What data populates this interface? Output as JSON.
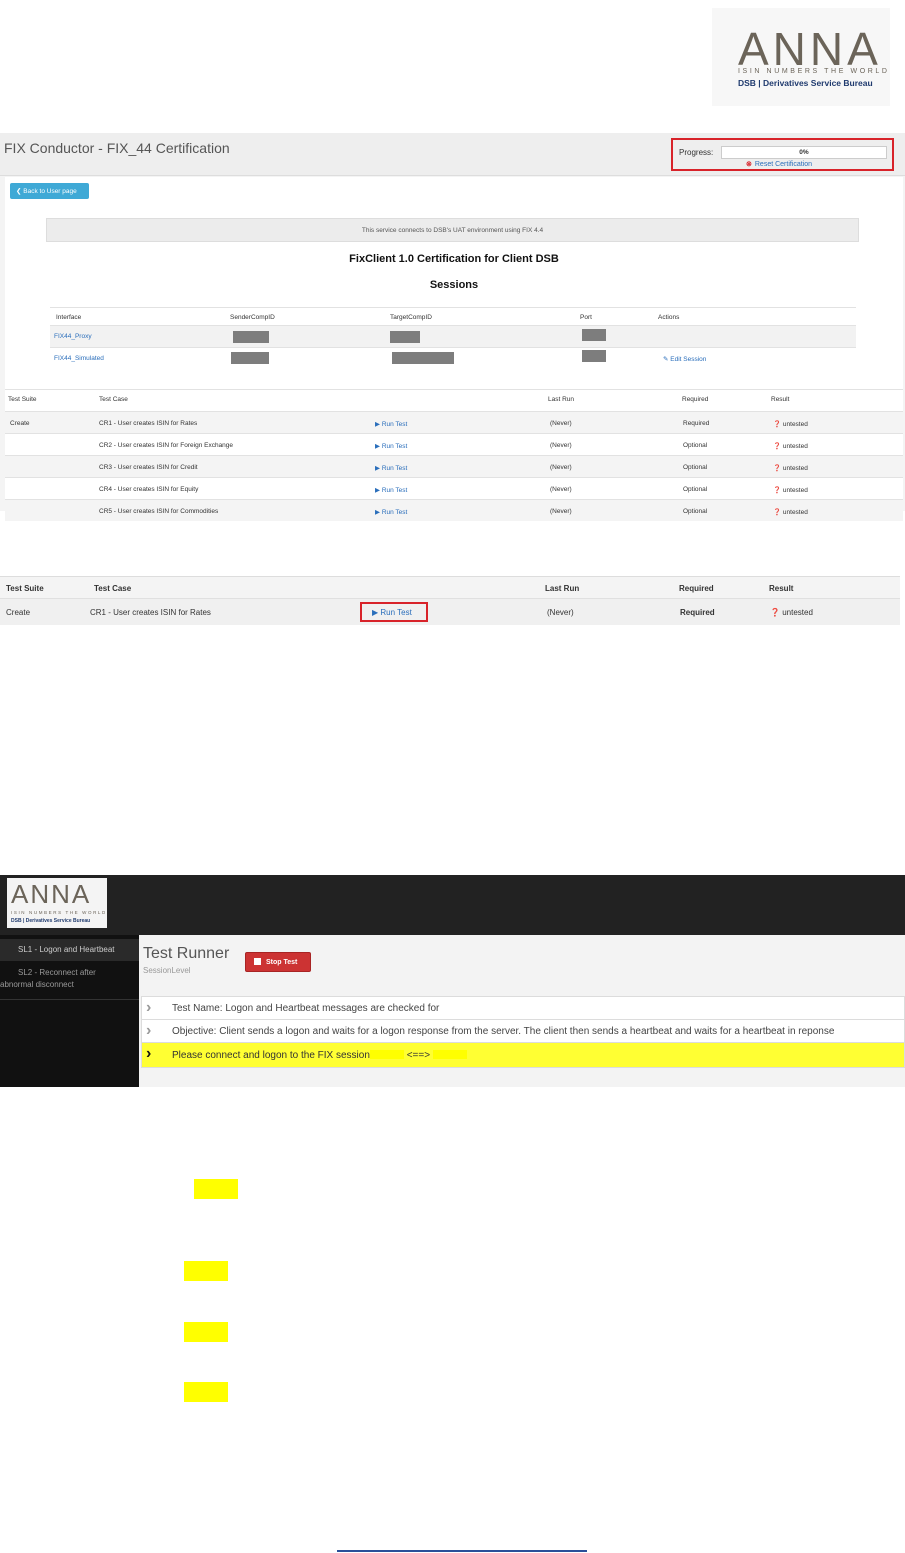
{
  "logo": {
    "main": "ANNA",
    "tagline": "ISIN NUMBERS THE WORLD",
    "subtitle": "DSB | Derivatives Service Bureau"
  },
  "panel1": {
    "title": "FIX Conductor - FIX_44 Certification",
    "progress_label": "Progress:",
    "progress_value": "0%",
    "progress_fraction": 0,
    "reset_label": "Reset Certification",
    "back_button": "Back to User page",
    "notice": "This service connects to DSB's UAT environment using FIX 4.4",
    "cert_title": "FixClient 1.0 Certification for Client DSB",
    "sessions_title": "Sessions",
    "sessions_headers": [
      "Interface",
      "SenderCompID",
      "TargetCompID",
      "Port",
      "Actions"
    ],
    "sessions": [
      {
        "interface": "FIX44_Proxy",
        "action": ""
      },
      {
        "interface": "FIX44_Simulated",
        "action": "Edit Session"
      }
    ],
    "tests_headers": [
      "Test Suite",
      "Test Case",
      "Last Run",
      "Required",
      "Result"
    ],
    "tests": [
      {
        "suite": "Create",
        "case": "CR1 - User creates ISIN for Rates",
        "run": "Run Test",
        "last_run": "(Never)",
        "required": "Required",
        "result": "untested"
      },
      {
        "suite": "",
        "case": "CR2 - User creates ISIN for Foreign Exchange",
        "run": "Run Test",
        "last_run": "(Never)",
        "required": "Optional",
        "result": "untested"
      },
      {
        "suite": "",
        "case": "CR3 - User creates ISIN for Credit",
        "run": "Run Test",
        "last_run": "(Never)",
        "required": "Optional",
        "result": "untested"
      },
      {
        "suite": "",
        "case": "CR4 - User creates ISIN for Equity",
        "run": "Run Test",
        "last_run": "(Never)",
        "required": "Optional",
        "result": "untested"
      },
      {
        "suite": "",
        "case": "CR5 - User creates ISIN for Commodities",
        "run": "Run Test",
        "last_run": "(Never)",
        "required": "Optional",
        "result": "untested"
      }
    ]
  },
  "panel2": {
    "headers": [
      "Test Suite",
      "Test Case",
      "Last Run",
      "Required",
      "Result"
    ],
    "row": {
      "suite": "Create",
      "case": "CR1 - User creates ISIN for Rates",
      "run": "Run Test",
      "last_run": "(Never)",
      "required": "Required",
      "result": "untested"
    }
  },
  "panel3": {
    "logo_main": "ANNA",
    "logo_tagline": "ISIN NUMBERS THE WORLD",
    "logo_subtitle": "DSB | Derivatives Service Bureau",
    "sidebar": {
      "item1": "SL1 - Logon and Heartbeat",
      "item2_line1": "SL2 - Reconnect after",
      "item2_line2": "abnormal disconnect"
    },
    "title": "Test Runner",
    "subtitle": "SessionLevel",
    "stop_button": "Stop Test",
    "test_name": "Test Name: Logon and Heartbeat messages are checked for",
    "objective": "Objective: Client sends a logon and waits for a logon response from the server. The client then sends a heartbeat and waits for a heartbeat in reponse",
    "instruction_prefix": "Please connect and logon to the FIX session",
    "instruction_arrow": "<==>"
  },
  "colors": {
    "highlight": "#ffff00",
    "callout": "#d8232a",
    "link": "#2a6ebb"
  }
}
